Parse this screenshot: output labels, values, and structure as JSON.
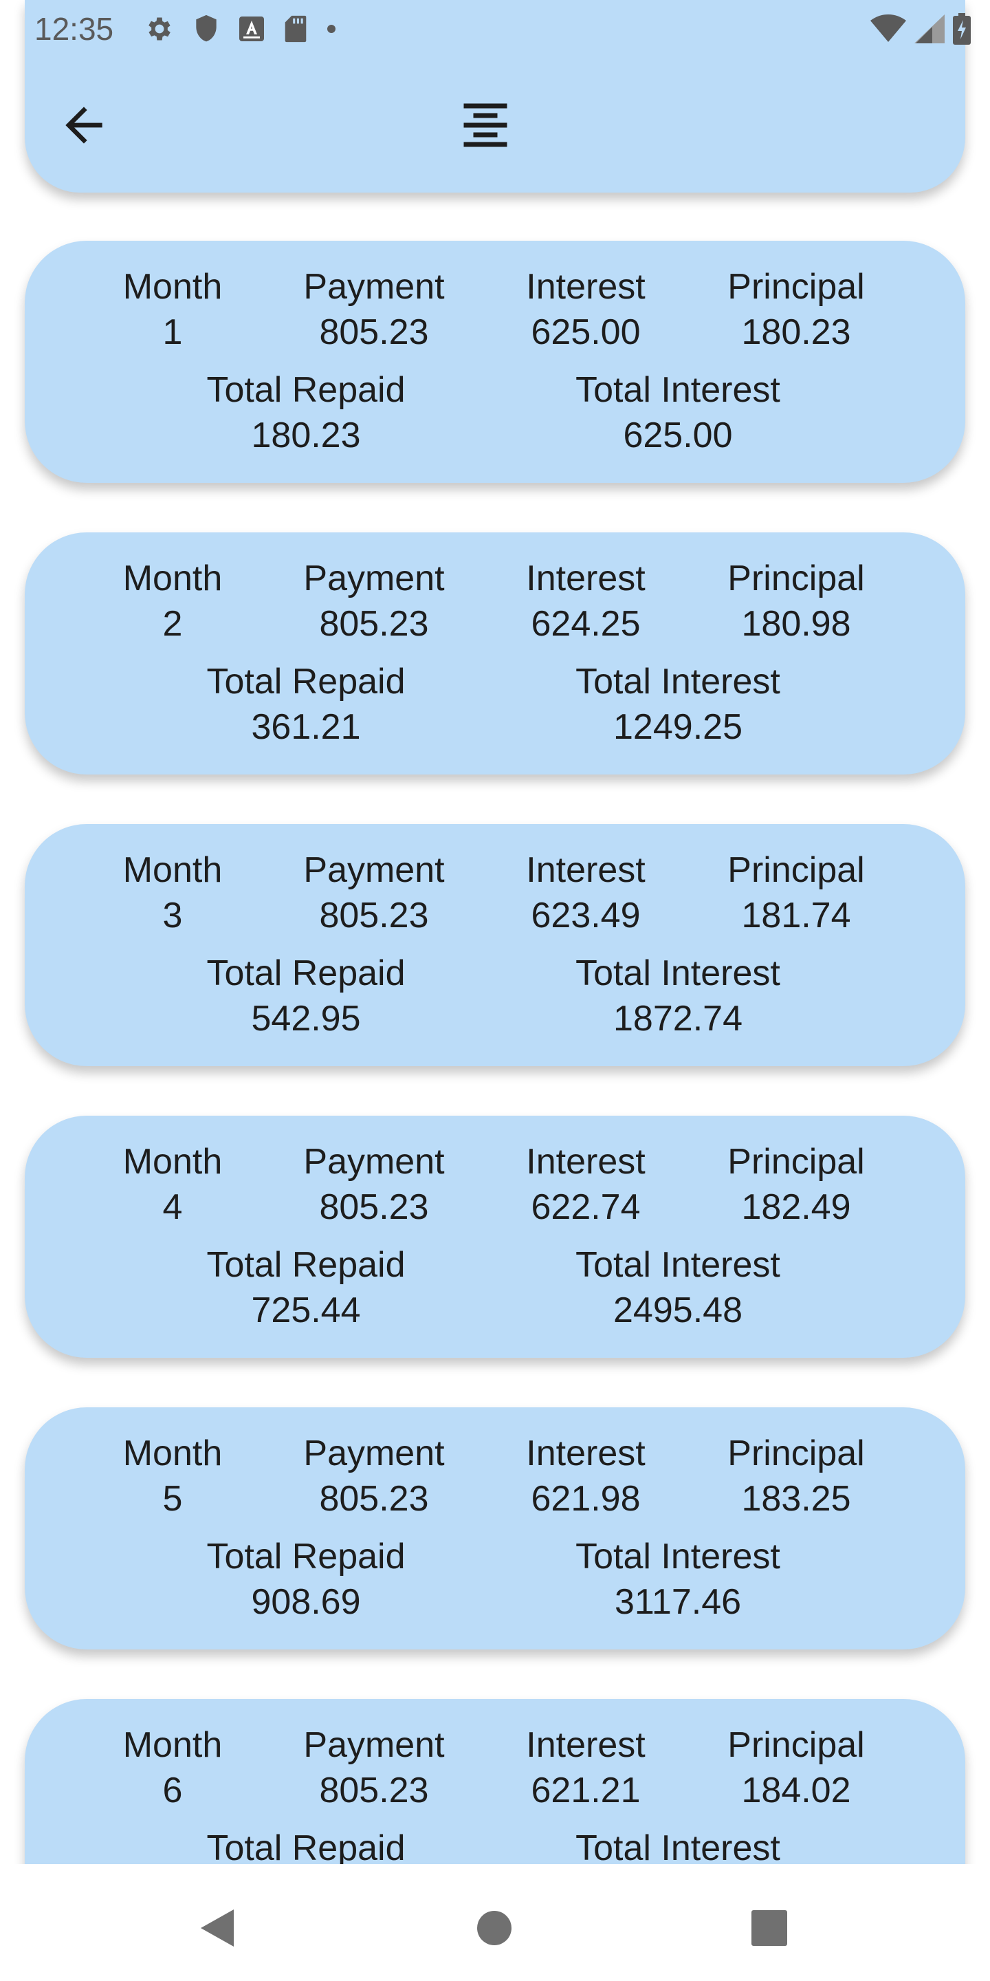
{
  "status_bar": {
    "time": "12:35",
    "left_icons": [
      "settings-gear-icon",
      "shield-icon",
      "text-a-icon",
      "sd-card-icon",
      "dot-icon"
    ],
    "right_icons": [
      "wifi-icon",
      "signal-icon",
      "battery-charging-icon"
    ]
  },
  "app_bar": {
    "back_icon": "arrow-back-icon",
    "action_icon": "format-align-center-icon",
    "background": "#bbdcf8"
  },
  "labels": {
    "month": "Month",
    "payment": "Payment",
    "interest": "Interest",
    "principal": "Principal",
    "total_repaid": "Total Repaid",
    "total_interest": "Total Interest"
  },
  "rows": [
    {
      "month": "1",
      "payment": "805.23",
      "interest": "625.00",
      "principal": "180.23",
      "total_repaid": "180.23",
      "total_interest": "625.00"
    },
    {
      "month": "2",
      "payment": "805.23",
      "interest": "624.25",
      "principal": "180.98",
      "total_repaid": "361.21",
      "total_interest": "1249.25"
    },
    {
      "month": "3",
      "payment": "805.23",
      "interest": "623.49",
      "principal": "181.74",
      "total_repaid": "542.95",
      "total_interest": "1872.74"
    },
    {
      "month": "4",
      "payment": "805.23",
      "interest": "622.74",
      "principal": "182.49",
      "total_repaid": "725.44",
      "total_interest": "2495.48"
    },
    {
      "month": "5",
      "payment": "805.23",
      "interest": "621.98",
      "principal": "183.25",
      "total_repaid": "908.69",
      "total_interest": "3117.46"
    },
    {
      "month": "6",
      "payment": "805.23",
      "interest": "621.21",
      "principal": "184.02",
      "total_repaid": "",
      "total_interest": ""
    }
  ],
  "nav_bar": {
    "icons": [
      "nav-back-icon",
      "nav-home-icon",
      "nav-recents-icon"
    ]
  }
}
